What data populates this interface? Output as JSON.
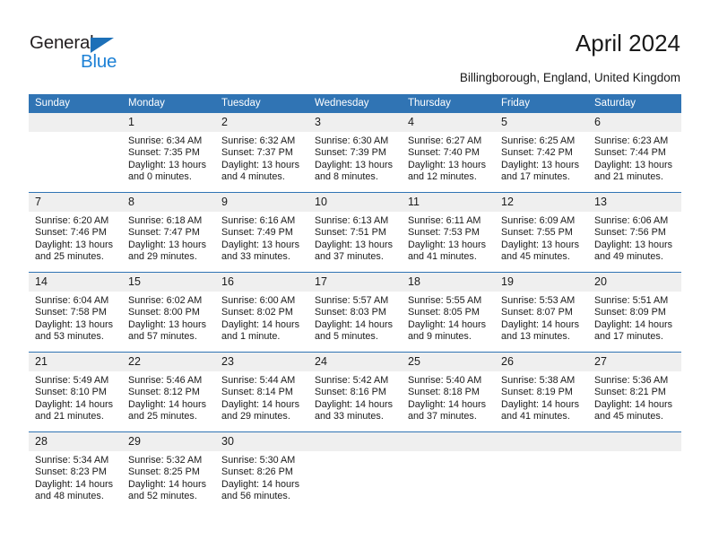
{
  "brand": {
    "name_top": "General",
    "name_bottom": "Blue",
    "triangle_color": "#1d70b8",
    "blue_text_color": "#1d81d6"
  },
  "header": {
    "title": "April 2024",
    "subtitle": "Billingborough, England, United Kingdom"
  },
  "theme": {
    "header_blue": "#3074b4",
    "daynum_band": "#efefef",
    "text": "#1a1a1a"
  },
  "calendar": {
    "weekday_headers": [
      "Sunday",
      "Monday",
      "Tuesday",
      "Wednesday",
      "Thursday",
      "Friday",
      "Saturday"
    ],
    "weeks": [
      [
        {
          "day": "",
          "empty": true
        },
        {
          "day": "1",
          "sunrise": "Sunrise: 6:34 AM",
          "sunset": "Sunset: 7:35 PM",
          "daylight": "Daylight: 13 hours and 0 minutes."
        },
        {
          "day": "2",
          "sunrise": "Sunrise: 6:32 AM",
          "sunset": "Sunset: 7:37 PM",
          "daylight": "Daylight: 13 hours and 4 minutes."
        },
        {
          "day": "3",
          "sunrise": "Sunrise: 6:30 AM",
          "sunset": "Sunset: 7:39 PM",
          "daylight": "Daylight: 13 hours and 8 minutes."
        },
        {
          "day": "4",
          "sunrise": "Sunrise: 6:27 AM",
          "sunset": "Sunset: 7:40 PM",
          "daylight": "Daylight: 13 hours and 12 minutes."
        },
        {
          "day": "5",
          "sunrise": "Sunrise: 6:25 AM",
          "sunset": "Sunset: 7:42 PM",
          "daylight": "Daylight: 13 hours and 17 minutes."
        },
        {
          "day": "6",
          "sunrise": "Sunrise: 6:23 AM",
          "sunset": "Sunset: 7:44 PM",
          "daylight": "Daylight: 13 hours and 21 minutes."
        }
      ],
      [
        {
          "day": "7",
          "sunrise": "Sunrise: 6:20 AM",
          "sunset": "Sunset: 7:46 PM",
          "daylight": "Daylight: 13 hours and 25 minutes."
        },
        {
          "day": "8",
          "sunrise": "Sunrise: 6:18 AM",
          "sunset": "Sunset: 7:47 PM",
          "daylight": "Daylight: 13 hours and 29 minutes."
        },
        {
          "day": "9",
          "sunrise": "Sunrise: 6:16 AM",
          "sunset": "Sunset: 7:49 PM",
          "daylight": "Daylight: 13 hours and 33 minutes."
        },
        {
          "day": "10",
          "sunrise": "Sunrise: 6:13 AM",
          "sunset": "Sunset: 7:51 PM",
          "daylight": "Daylight: 13 hours and 37 minutes."
        },
        {
          "day": "11",
          "sunrise": "Sunrise: 6:11 AM",
          "sunset": "Sunset: 7:53 PM",
          "daylight": "Daylight: 13 hours and 41 minutes."
        },
        {
          "day": "12",
          "sunrise": "Sunrise: 6:09 AM",
          "sunset": "Sunset: 7:55 PM",
          "daylight": "Daylight: 13 hours and 45 minutes."
        },
        {
          "day": "13",
          "sunrise": "Sunrise: 6:06 AM",
          "sunset": "Sunset: 7:56 PM",
          "daylight": "Daylight: 13 hours and 49 minutes."
        }
      ],
      [
        {
          "day": "14",
          "sunrise": "Sunrise: 6:04 AM",
          "sunset": "Sunset: 7:58 PM",
          "daylight": "Daylight: 13 hours and 53 minutes."
        },
        {
          "day": "15",
          "sunrise": "Sunrise: 6:02 AM",
          "sunset": "Sunset: 8:00 PM",
          "daylight": "Daylight: 13 hours and 57 minutes."
        },
        {
          "day": "16",
          "sunrise": "Sunrise: 6:00 AM",
          "sunset": "Sunset: 8:02 PM",
          "daylight": "Daylight: 14 hours and 1 minute."
        },
        {
          "day": "17",
          "sunrise": "Sunrise: 5:57 AM",
          "sunset": "Sunset: 8:03 PM",
          "daylight": "Daylight: 14 hours and 5 minutes."
        },
        {
          "day": "18",
          "sunrise": "Sunrise: 5:55 AM",
          "sunset": "Sunset: 8:05 PM",
          "daylight": "Daylight: 14 hours and 9 minutes."
        },
        {
          "day": "19",
          "sunrise": "Sunrise: 5:53 AM",
          "sunset": "Sunset: 8:07 PM",
          "daylight": "Daylight: 14 hours and 13 minutes."
        },
        {
          "day": "20",
          "sunrise": "Sunrise: 5:51 AM",
          "sunset": "Sunset: 8:09 PM",
          "daylight": "Daylight: 14 hours and 17 minutes."
        }
      ],
      [
        {
          "day": "21",
          "sunrise": "Sunrise: 5:49 AM",
          "sunset": "Sunset: 8:10 PM",
          "daylight": "Daylight: 14 hours and 21 minutes."
        },
        {
          "day": "22",
          "sunrise": "Sunrise: 5:46 AM",
          "sunset": "Sunset: 8:12 PM",
          "daylight": "Daylight: 14 hours and 25 minutes."
        },
        {
          "day": "23",
          "sunrise": "Sunrise: 5:44 AM",
          "sunset": "Sunset: 8:14 PM",
          "daylight": "Daylight: 14 hours and 29 minutes."
        },
        {
          "day": "24",
          "sunrise": "Sunrise: 5:42 AM",
          "sunset": "Sunset: 8:16 PM",
          "daylight": "Daylight: 14 hours and 33 minutes."
        },
        {
          "day": "25",
          "sunrise": "Sunrise: 5:40 AM",
          "sunset": "Sunset: 8:18 PM",
          "daylight": "Daylight: 14 hours and 37 minutes."
        },
        {
          "day": "26",
          "sunrise": "Sunrise: 5:38 AM",
          "sunset": "Sunset: 8:19 PM",
          "daylight": "Daylight: 14 hours and 41 minutes."
        },
        {
          "day": "27",
          "sunrise": "Sunrise: 5:36 AM",
          "sunset": "Sunset: 8:21 PM",
          "daylight": "Daylight: 14 hours and 45 minutes."
        }
      ],
      [
        {
          "day": "28",
          "sunrise": "Sunrise: 5:34 AM",
          "sunset": "Sunset: 8:23 PM",
          "daylight": "Daylight: 14 hours and 48 minutes."
        },
        {
          "day": "29",
          "sunrise": "Sunrise: 5:32 AM",
          "sunset": "Sunset: 8:25 PM",
          "daylight": "Daylight: 14 hours and 52 minutes."
        },
        {
          "day": "30",
          "sunrise": "Sunrise: 5:30 AM",
          "sunset": "Sunset: 8:26 PM",
          "daylight": "Daylight: 14 hours and 56 minutes."
        },
        {
          "day": "",
          "empty": true
        },
        {
          "day": "",
          "empty": true
        },
        {
          "day": "",
          "empty": true
        },
        {
          "day": "",
          "empty": true
        }
      ]
    ]
  }
}
